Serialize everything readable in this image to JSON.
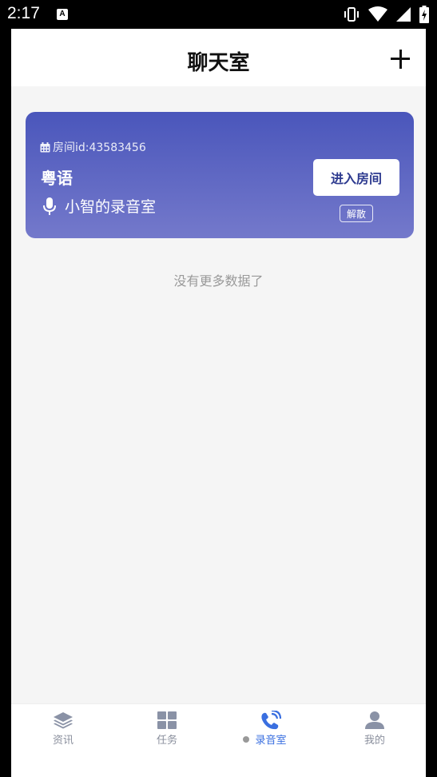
{
  "status_bar": {
    "time": "2:17",
    "notification_badge": "A"
  },
  "header": {
    "title": "聊天室",
    "add_icon": "plus-icon"
  },
  "room_card": {
    "room_id": "房间id:43583456",
    "language": "粤语",
    "owner": "小智的录音室",
    "enter_label": "进入房间",
    "dissolve_label": "解散",
    "gradient_top": "#4a56bb",
    "gradient_bottom": "#7479cb"
  },
  "empty_hint": "没有更多数据了",
  "tabbar": {
    "active_color": "#3a6fe0",
    "items": [
      {
        "label": "资讯",
        "icon": "layers-icon"
      },
      {
        "label": "任务",
        "icon": "grid-icon"
      },
      {
        "label": "录音室",
        "icon": "phone-icon"
      },
      {
        "label": "我的",
        "icon": "user-icon"
      }
    ]
  }
}
